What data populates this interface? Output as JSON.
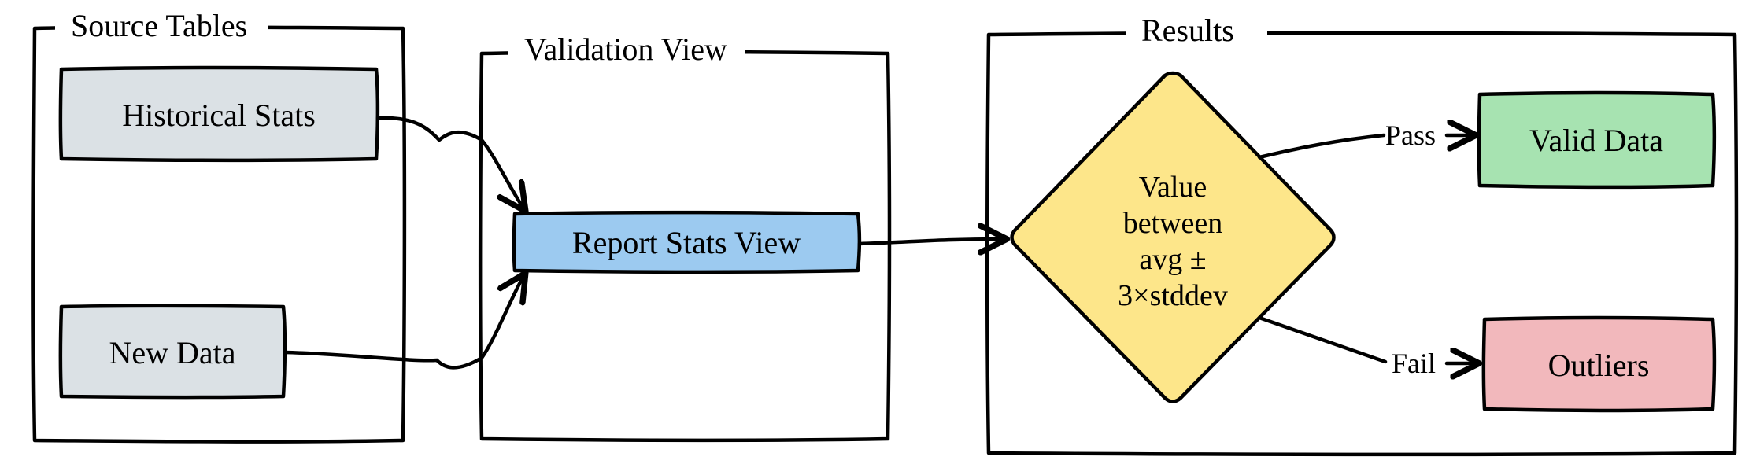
{
  "groups": {
    "source": {
      "title": "Source Tables"
    },
    "validation": {
      "title": "Validation View"
    },
    "results": {
      "title": "Results"
    }
  },
  "nodes": {
    "historical": {
      "label": "Historical Stats"
    },
    "newdata": {
      "label": "New Data"
    },
    "reportstats": {
      "label": "Report Stats View"
    },
    "decision": {
      "line1": "Value",
      "line2": "between",
      "line3": "avg ±",
      "line4": "3×stddev"
    },
    "validdata": {
      "label": "Valid Data"
    },
    "outliers": {
      "label": "Outliers"
    }
  },
  "edges": {
    "pass": {
      "label": "Pass"
    },
    "fail": {
      "label": "Fail"
    }
  },
  "colors": {
    "gray": "#dbe1e5",
    "blue": "#9ccaf0",
    "yellow": "#fde68a",
    "green": "#a7e3b1",
    "red": "#f2b8bc",
    "stroke": "#000000",
    "bg": "#ffffff"
  }
}
